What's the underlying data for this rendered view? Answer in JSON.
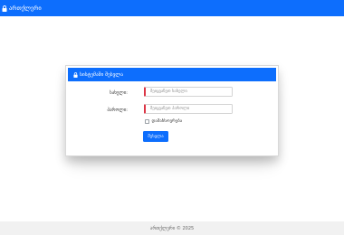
{
  "navbar": {
    "brand_label": "ართქლერი",
    "brand_icon": "lock-icon",
    "color": "#0d6efd"
  },
  "login_card": {
    "title": "სისტემაში შესვლა",
    "title_icon": "lock-icon",
    "username": {
      "label": "სახელი:",
      "placeholder": "შეიყვანეთ სახელი",
      "value": ""
    },
    "password": {
      "label": "პაროლი:",
      "placeholder": "შეიყვანეთ პაროლი",
      "value": ""
    },
    "remember": {
      "label": "დამახსოვრება",
      "checked": false
    },
    "submit_label": "შესვლა"
  },
  "footer": {
    "text": "ართქლერი © 2025"
  },
  "colors": {
    "primary": "#0d6efd",
    "invalid_border": "#dc3545",
    "footer_bg": "#f1f1f1"
  }
}
